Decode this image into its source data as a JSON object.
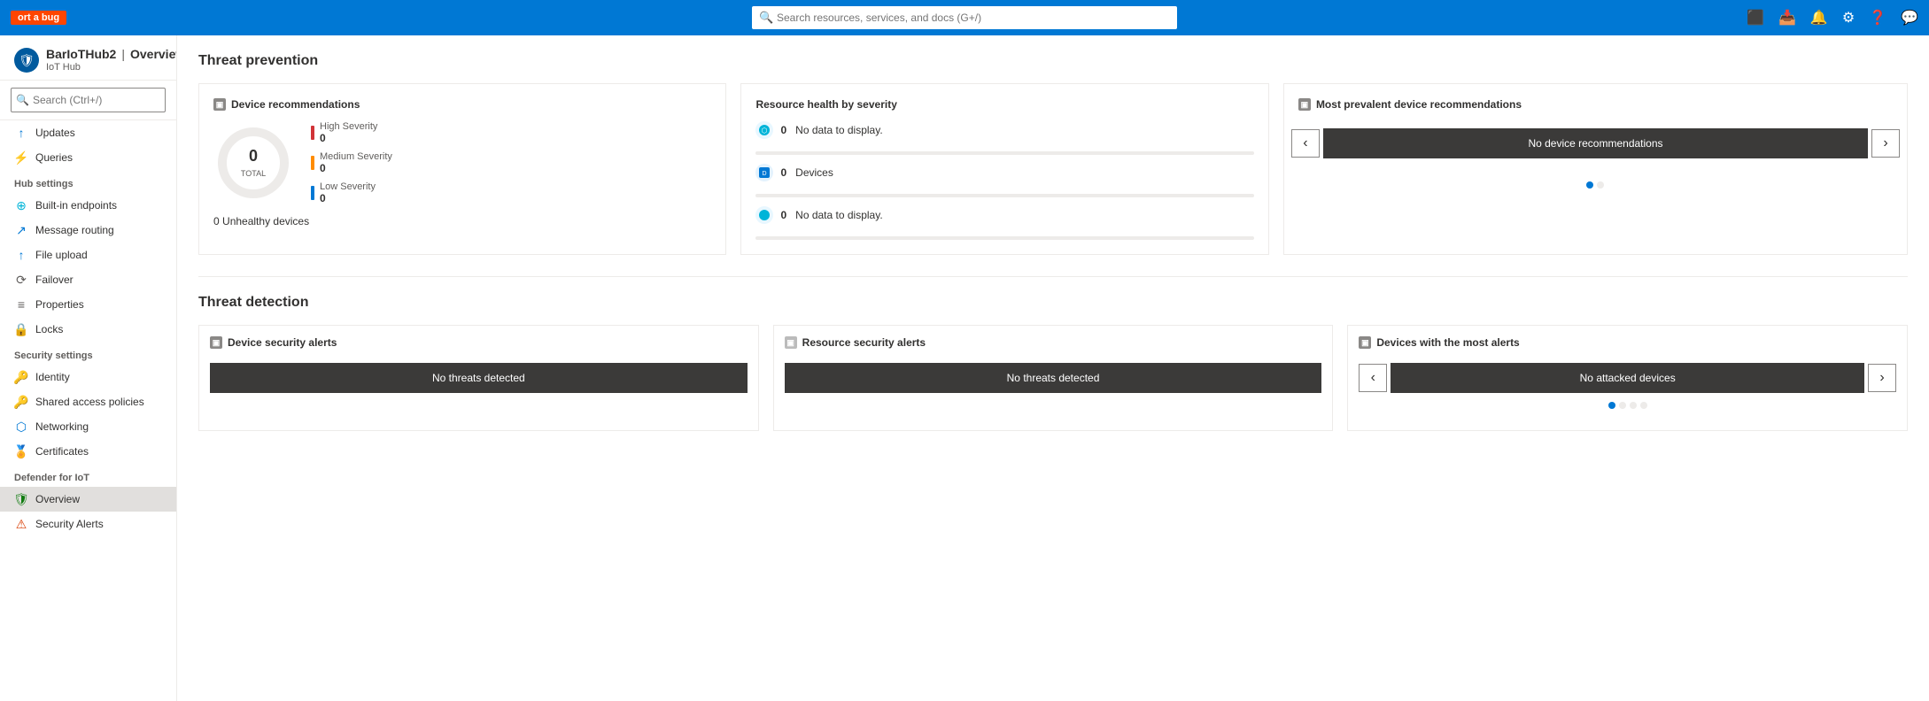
{
  "topbar": {
    "bug_label": "ort a bug",
    "search_placeholder": "Search resources, services, and docs (G+/)"
  },
  "resource": {
    "name": "BarIoTHub2",
    "separator": "|",
    "page": "Overview",
    "more": "...",
    "type": "IoT Hub"
  },
  "sidebar": {
    "search_placeholder": "Search (Ctrl+/)",
    "sections": [
      {
        "label": "",
        "items": [
          {
            "id": "updates",
            "label": "Updates",
            "icon": "↑",
            "icon_class": "icon-blue"
          },
          {
            "id": "queries",
            "label": "Queries",
            "icon": "⚡",
            "icon_class": "icon-blue"
          }
        ]
      },
      {
        "label": "Hub settings",
        "items": [
          {
            "id": "built-in-endpoints",
            "label": "Built-in endpoints",
            "icon": "⊕",
            "icon_class": "icon-teal"
          },
          {
            "id": "message-routing",
            "label": "Message routing",
            "icon": "↗",
            "icon_class": "icon-blue"
          },
          {
            "id": "file-upload",
            "label": "File upload",
            "icon": "↑",
            "icon_class": "icon-blue"
          },
          {
            "id": "failover",
            "label": "Failover",
            "icon": "⟳",
            "icon_class": "icon-gray"
          },
          {
            "id": "properties",
            "label": "Properties",
            "icon": "≡",
            "icon_class": "icon-gray"
          },
          {
            "id": "locks",
            "label": "Locks",
            "icon": "🔒",
            "icon_class": "icon-gray"
          }
        ]
      },
      {
        "label": "Security settings",
        "items": [
          {
            "id": "identity",
            "label": "Identity",
            "icon": "🔑",
            "icon_class": "icon-yellow"
          },
          {
            "id": "shared-access-policies",
            "label": "Shared access policies",
            "icon": "🔑",
            "icon_class": "icon-yellow"
          },
          {
            "id": "networking",
            "label": "Networking",
            "icon": "⬡",
            "icon_class": "icon-blue"
          },
          {
            "id": "certificates",
            "label": "Certificates",
            "icon": "🏅",
            "icon_class": "icon-green"
          }
        ]
      },
      {
        "label": "Defender for IoT",
        "items": [
          {
            "id": "overview",
            "label": "Overview",
            "icon": "🛡",
            "icon_class": "icon-green",
            "active": true
          },
          {
            "id": "security-alerts",
            "label": "Security Alerts",
            "icon": "⚠",
            "icon_class": "icon-orange"
          }
        ]
      }
    ]
  },
  "threat_prevention": {
    "title": "Threat prevention",
    "device_recommendations": {
      "title": "Device recommendations",
      "donut": {
        "total_label": "TOTAL",
        "total_value": "0"
      },
      "severities": [
        {
          "label": "High Severity",
          "value": "0",
          "color": "#d13438"
        },
        {
          "label": "Medium Severity",
          "value": "0",
          "color": "#ff8c00"
        },
        {
          "label": "Low Severity",
          "value": "0",
          "color": "#0078d4"
        }
      ],
      "unhealthy_label": "Unhealthy devices",
      "unhealthy_value": "0"
    },
    "resource_health": {
      "title": "Resource health by severity",
      "items": [
        {
          "label": "No data to display.",
          "value": "0",
          "icon_color": "#00b4d8"
        },
        {
          "label": "Devices",
          "value": "0",
          "icon_color": "#0078d4"
        },
        {
          "label": "No data to display.",
          "value": "0",
          "icon_color": "#00b4d8"
        }
      ]
    },
    "most_prevalent": {
      "title": "Most prevalent device recommendations",
      "btn_label": "No device recommendations",
      "dots": [
        true,
        false
      ]
    }
  },
  "threat_detection": {
    "title": "Threat detection",
    "device_security_alerts": {
      "title": "Device security alerts",
      "btn_label": "No threats detected"
    },
    "resource_security_alerts": {
      "title": "Resource security alerts",
      "btn_label": "No threats detected"
    },
    "devices_most_alerts": {
      "title": "Devices with the most alerts",
      "btn_label": "No attacked devices",
      "dots": [
        true,
        false,
        false,
        false
      ]
    }
  }
}
